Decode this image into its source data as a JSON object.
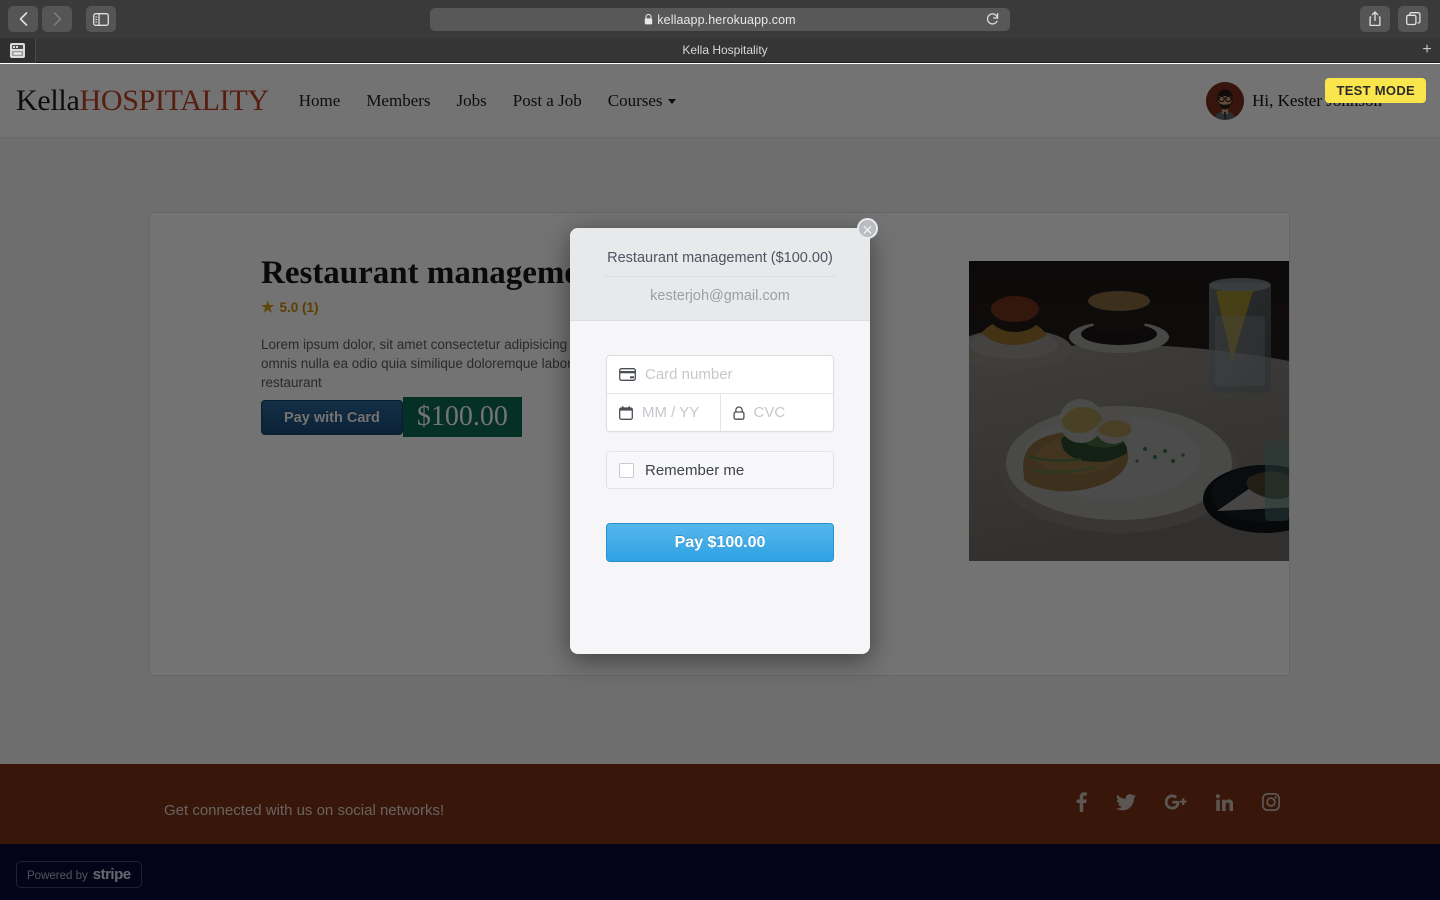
{
  "browser": {
    "url": "kellaapp.herokuapp.com",
    "back_label": "Back",
    "forward_label": "Forward",
    "sidebar_label": "Show Sidebar",
    "share_label": "Share",
    "tabs_overview_label": "Tab Overview",
    "reload_label": "Reload",
    "tab_title": "Kella Hospitality",
    "new_tab_label": "+"
  },
  "site": {
    "logo_primary": "Kella",
    "logo_secondary": "HOSPITALITY",
    "nav": [
      {
        "label": "Home"
      },
      {
        "label": "Members"
      },
      {
        "label": "Jobs"
      },
      {
        "label": "Post a Job"
      },
      {
        "label": "Courses",
        "has_caret": true
      }
    ],
    "greeting": "Hi, Kester Johnson",
    "test_mode_badge": "TEST MODE"
  },
  "course": {
    "title": "Restaurant management",
    "rating_value": "5.0 (1)",
    "star_glyph": "★",
    "description": "Lorem ipsum dolor, sit amet consectetur adipisicing elit. Id numquam quas, voluptates omnis nulla ea odio quia similique doloremque laborum. Learn how to manage a restaurant",
    "pay_button_label": "Pay with Card",
    "price_label": "$100.00"
  },
  "footer": {
    "social_text": "Get connected with us on social networks!",
    "social_icons": [
      {
        "name": "facebook"
      },
      {
        "name": "twitter"
      },
      {
        "name": "google-plus"
      },
      {
        "name": "linkedin"
      },
      {
        "name": "instagram"
      }
    ],
    "stripe_powered_by": "Powered by",
    "stripe_wordmark": "stripe"
  },
  "modal": {
    "title": "Restaurant management ($100.00)",
    "email": "kesterjoh@gmail.com",
    "close_glyph": "✕",
    "card_number_placeholder": "Card number",
    "card_number_value": "",
    "expiry_placeholder": "MM / YY",
    "expiry_value": "",
    "cvc_placeholder": "CVC",
    "cvc_value": "",
    "remember_label": "Remember me",
    "remember_checked": false,
    "pay_label": "Pay $100.00"
  },
  "colors": {
    "brand_orange": "#bf4423",
    "footer_brown": "#7c3217",
    "stripe_navy": "#0b0b38",
    "stripe_blue": "#2fa2e4",
    "price_green": "#0d6b52",
    "test_mode_yellow": "#fbe54c",
    "star_gold": "#d4a017"
  }
}
